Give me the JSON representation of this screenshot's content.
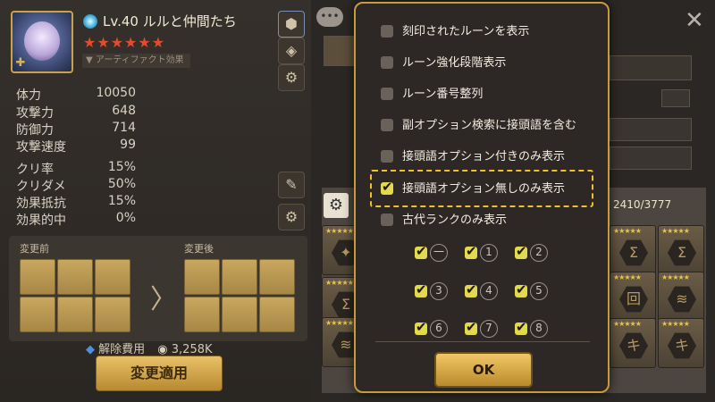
{
  "monster": {
    "level": "Lv.40",
    "name": "ルルと仲間たち",
    "stars": "★★★★★★",
    "artifact_label": "▼ アーティファクト効果"
  },
  "stats": [
    {
      "label": "体力",
      "value": "10050"
    },
    {
      "label": "攻撃力",
      "value": "648"
    },
    {
      "label": "防御力",
      "value": "714"
    },
    {
      "label": "攻撃速度",
      "value": "99"
    },
    {
      "label": "クリ率",
      "value": "15%"
    },
    {
      "label": "クリダメ",
      "value": "50%"
    },
    {
      "label": "効果抵抗",
      "value": "15%"
    },
    {
      "label": "効果的中",
      "value": "0%"
    }
  ],
  "change": {
    "before_label": "変更前",
    "after_label": "変更後",
    "cost_label": "解除費用",
    "cost_value": "3,258K",
    "apply_button": "変更適用"
  },
  "inventory": {
    "count": "2410/3777"
  },
  "options": [
    {
      "label": "刻印されたルーンを表示",
      "checked": false
    },
    {
      "label": "ルーン強化段階表示",
      "checked": false
    },
    {
      "label": "ルーン番号整列",
      "checked": false
    },
    {
      "label": "副オプション検索に接頭語を含む",
      "checked": false
    },
    {
      "label": "接頭語オプション付きのみ表示",
      "checked": false
    },
    {
      "label": "接頭語オプション無しのみ表示",
      "checked": true
    },
    {
      "label": "古代ランクのみ表示",
      "checked": false
    }
  ],
  "ranks": [
    "一",
    "1",
    "2",
    "3",
    "4",
    "5",
    "6",
    "7",
    "8"
  ],
  "ok_button": "OK",
  "colors": {
    "panel_border": "#c99a3c",
    "highlight": "#f2c02a",
    "checkbox_checked": "#e2d94c"
  }
}
